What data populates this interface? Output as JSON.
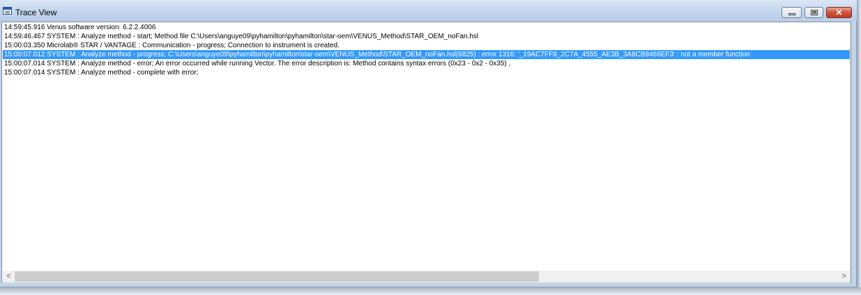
{
  "window": {
    "title": "Trace View",
    "controls": {
      "minimize_icon": "minimize-icon",
      "maximize_icon": "restore-icon",
      "close_label": "✕"
    },
    "accent_color": "#3399ff"
  },
  "log": {
    "lines": [
      "14:59:45.916 Venus software version: 6.2.2.4006",
      "14:59:46.467 SYSTEM : Analyze method - start; Method file C:\\Users\\anguye09\\pyhamilton\\pyhamilton\\star-oem\\VENUS_Method\\STAR_OEM_noFan.hsl",
      "15:00:03.350 Microlab® STAR / VANTAGE : Communication - progress; Connection to instrument is created.",
      "15:00:07.012 SYSTEM : Analyze method - progress; C:\\Users\\anguye09\\pyhamilton\\pyhamilton\\star-oem\\VENUS_Method\\STAR_OEM_noFan.hsl(6825) : error 1316: '_19AC7FF8_2C7A_4555_AE3B_3A8CB9466EF3' : not a member function",
      "15:00:07.014 SYSTEM : Analyze method - error; An error occurred while running Vector.  The error description is: Method contains syntax errors (0x23 - 0x2 - 0x35) ,",
      "15:00:07.014 SYSTEM : Analyze method - complete with error;"
    ],
    "selected_index": 3
  },
  "scrollbar": {
    "left_arrow": "<",
    "right_arrow": ">"
  }
}
